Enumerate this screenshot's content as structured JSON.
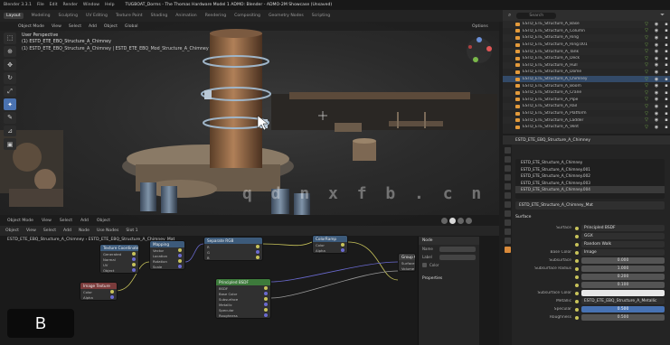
{
  "app": {
    "menu": [
      "Blender 3.3.1",
      "File",
      "Edit",
      "Render",
      "Window",
      "Help"
    ],
    "window_title": "TUGBOAT_Dorms - The Thomas Hardware Model 1 ADMO: Blender - ADMO-2M Showcase (Unsaved)"
  },
  "workspaces": [
    "Layout",
    "Modeling",
    "Sculpting",
    "UV Editing",
    "Texture Paint",
    "Shading",
    "Animation",
    "Rendering",
    "Compositing",
    "Geometry Nodes",
    "Scripting"
  ],
  "active_workspace": "Layout",
  "viewport": {
    "header": [
      "Object Mode",
      "View",
      "Select",
      "Add",
      "Object",
      "Global"
    ],
    "info_lines": [
      "User Perspective",
      "(1) ESTD_ETE_EBQ_Structure_A_Chimney"
    ],
    "object_path": "(1) ESTD_ETE_EBQ_Structure_A_Chimney | ESTD_ETE_EBQ_Mod_Structure_A_Chimney",
    "bottom": [
      "Object Mode",
      "View",
      "Select",
      "Add",
      "Object"
    ],
    "options_label": "Options"
  },
  "watermark": "q d n x f b . c n",
  "outliner": {
    "search_placeholder": "Search",
    "filter_label": "Filter",
    "rows": [
      "ESTD_ETE_Structure_A_Base",
      "ESTD_ETE_Structure_A_Column",
      "ESTD_ETE_Structure_A_Ring",
      "ESTD_ETE_Structure_A_Ring.001",
      "ESTD_ETE_Structure_A_Tank",
      "ESTD_ETE_Structure_A_Deck",
      "ESTD_ETE_Structure_A_Hull",
      "ESTD_ETE_Structure_A_Dome",
      "ESTD_ETE_Structure_A_Chimney",
      "ESTD_ETE_Structure_A_Boom",
      "ESTD_ETE_Structure_A_Crane",
      "ESTD_ETE_Structure_A_Pipe",
      "ESTD_ETE_Structure_A_Rail",
      "ESTD_ETE_Structure_A_Platform",
      "ESTD_ETE_Structure_A_Ladder",
      "ESTD_ETE_Structure_A_Vent"
    ],
    "selected_index": 8
  },
  "properties": {
    "object_name": "ESTD_ETE_EBQ_Structure_A_Chimney",
    "list_items": [
      "ESTD_ETE_Structure_A_Chimney",
      "ESTD_ETE_Structure_A_Chimney.001",
      "ESTD_ETE_Structure_A_Chimney.002",
      "ESTD_ETE_Structure_A_Chimney.003",
      "ESTD_ETE_Structure_A_Chimney.004"
    ],
    "material_name": "ESTD_ETE_Structure_A_Chimney_Mat",
    "section": "Surface",
    "rows": [
      {
        "label": "Surface",
        "value": "Principled BSDF",
        "style": "dark"
      },
      {
        "label": "",
        "value": "GGX",
        "style": "dark"
      },
      {
        "label": "",
        "value": "Random Walk",
        "style": "dark"
      },
      {
        "label": "Base Color",
        "value": "Image",
        "style": "dark"
      },
      {
        "label": "Subsurface",
        "value": "0.000",
        "style": ""
      },
      {
        "label": "Subsurface Radius",
        "value": "1.000",
        "style": ""
      },
      {
        "label": "",
        "value": "0.200",
        "style": ""
      },
      {
        "label": "",
        "value": "0.100",
        "style": ""
      },
      {
        "label": "Subsurface Color",
        "value": "",
        "style": "white"
      },
      {
        "label": "Metallic",
        "value": "ESTD_ETE_EBQ_Structure_A_Metallic",
        "style": "dark"
      },
      {
        "label": "Specular",
        "value": "0.500",
        "style": "blue"
      },
      {
        "label": "Roughness",
        "value": "0.500",
        "style": ""
      }
    ]
  },
  "node_editor": {
    "header": [
      "Object",
      "View",
      "Select",
      "Add",
      "Node",
      "Use Nodes",
      "Slot 1"
    ],
    "path": "ESTD_ETE_EBQ_Structure_A_Chimney",
    "material_path": "ESTD_ETE_EBQ_Structure_A_Chimney_Mat",
    "side_items": [
      "Node",
      "Name",
      "Label",
      "Color",
      "Properties"
    ],
    "nodes": [
      {
        "title": "Image Texture",
        "color": "#7a3b3b",
        "rows": [
          "Color",
          "Alpha"
        ]
      },
      {
        "title": "Mapping",
        "color": "#3c5a7a",
        "rows": [
          "Vector",
          "Location",
          "Rotation",
          "Scale"
        ]
      },
      {
        "title": "Texture Coordinate",
        "color": "#3c5a7a",
        "rows": [
          "Generated",
          "Normal",
          "UV",
          "Object"
        ]
      },
      {
        "title": "Separate RGB",
        "color": "#3c5a7a",
        "rows": [
          "R",
          "G",
          "B"
        ]
      },
      {
        "title": "Principled BSDF",
        "color": "#3d7a3b",
        "rows": [
          "BSDF",
          "Base Color",
          "Subsurface",
          "Metallic",
          "Specular",
          "Roughness"
        ]
      },
      {
        "title": "ColorRamp",
        "color": "#3c5a7a",
        "rows": [
          "Color",
          "Alpha"
        ]
      },
      {
        "title": "Group Output",
        "color": "#3c3c3c",
        "rows": [
          "Surface",
          "Volume"
        ]
      }
    ]
  },
  "logo_text": "B",
  "colors": {
    "accent": "#4772b3",
    "orange": "#e39a3b",
    "bg": "#1d1d1d"
  }
}
